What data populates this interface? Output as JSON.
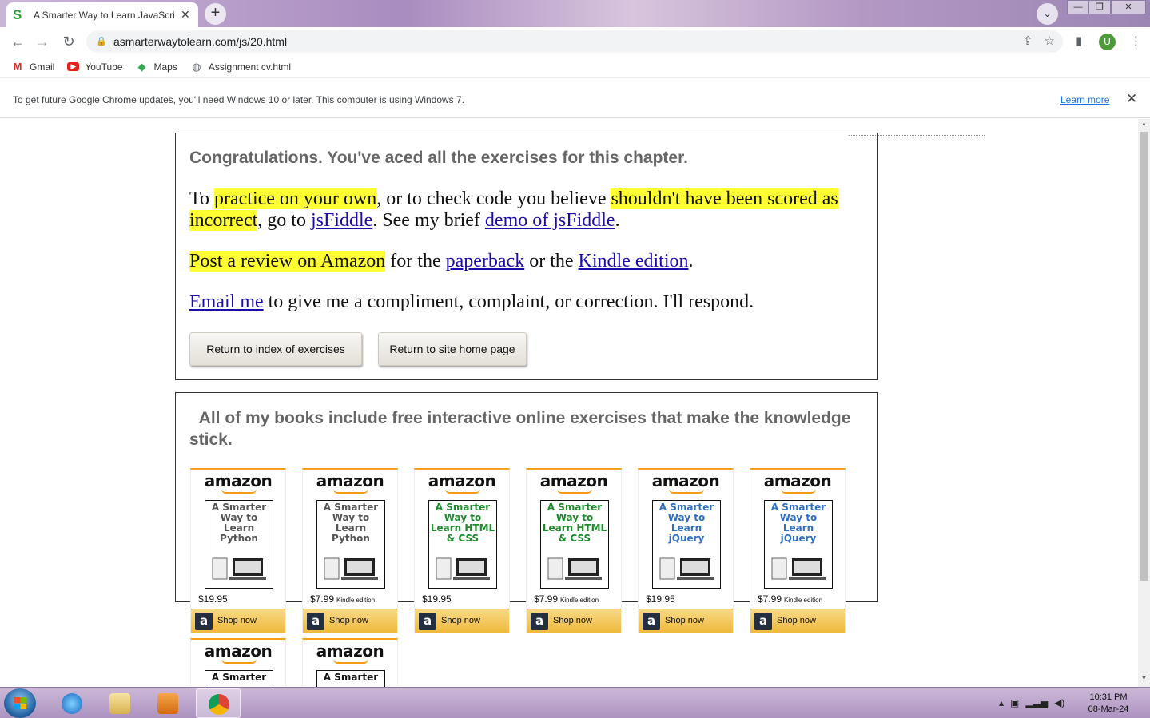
{
  "browser": {
    "tab_title": "A Smarter Way to Learn JavaScript",
    "tab_favicon": "S",
    "url": "asmarterwaytolearn.com/js/20.html",
    "avatar_letter": "U",
    "bookmarks": [
      {
        "label": "Gmail",
        "icon": "gmail-icon"
      },
      {
        "label": "YouTube",
        "icon": "youtube-icon"
      },
      {
        "label": "Maps",
        "icon": "maps-icon"
      },
      {
        "label": "Assignment cv.html",
        "icon": "globe-icon"
      }
    ],
    "infobar": {
      "message": "To get future Google Chrome updates, you'll need Windows 10 or later. This computer is using Windows 7.",
      "link": "Learn more"
    }
  },
  "page": {
    "congrats": "Congratulations. You've aced all the exercises for this chapter.",
    "p1": {
      "t1": "To ",
      "h1": "practice on your own",
      "t2": ", or to check code you believe ",
      "h2": "shouldn't have been scored as incorrect",
      "t3": ", go to ",
      "l1": "jsFiddle",
      "t4": ". See my brief ",
      "l2": "demo of jsFiddle",
      "t5": "."
    },
    "p2": {
      "h1": "Post a review on Amazon",
      "t1": " for the ",
      "l1": "paperback",
      "t2": " or the ",
      "l2": "Kindle edition",
      "t3": "."
    },
    "p3": {
      "l1": "Email me",
      "t1": " to give me a compliment, complaint, or correction. I'll respond."
    },
    "buttons": {
      "index": "Return to index of exercises",
      "home": "Return to site home page"
    },
    "books_heading": "All of my books include free interactive online exercises that make the knowledge stick.",
    "brand": "amazon",
    "shop_label": "Shop now",
    "books": [
      {
        "title": "A Smarter Way to Learn Python",
        "price": "$19.95",
        "kindle": "",
        "color": "#555555"
      },
      {
        "title": "A Smarter Way to Learn Python",
        "price": "$7.99",
        "kindle": "Kindle edition",
        "color": "#555555"
      },
      {
        "title": "A Smarter Way to Learn HTML & CSS",
        "price": "$19.95",
        "kindle": "",
        "color": "#1f8a2e"
      },
      {
        "title": "A Smarter Way to Learn HTML & CSS",
        "price": "$7.99",
        "kindle": "Kindle edition",
        "color": "#1f8a2e"
      },
      {
        "title": "A Smarter Way to Learn jQuery",
        "price": "$19.95",
        "kindle": "",
        "color": "#2f6fc1"
      },
      {
        "title": "A Smarter Way to Learn jQuery",
        "price": "$7.99",
        "kindle": "Kindle edition",
        "color": "#2f6fc1"
      },
      {
        "title": "A Smarter",
        "price": "",
        "kindle": "",
        "color": "#111111"
      },
      {
        "title": "A Smarter",
        "price": "",
        "kindle": "",
        "color": "#111111"
      }
    ]
  },
  "taskbar": {
    "time": "10:31 PM",
    "date": "08-Mar-24"
  }
}
